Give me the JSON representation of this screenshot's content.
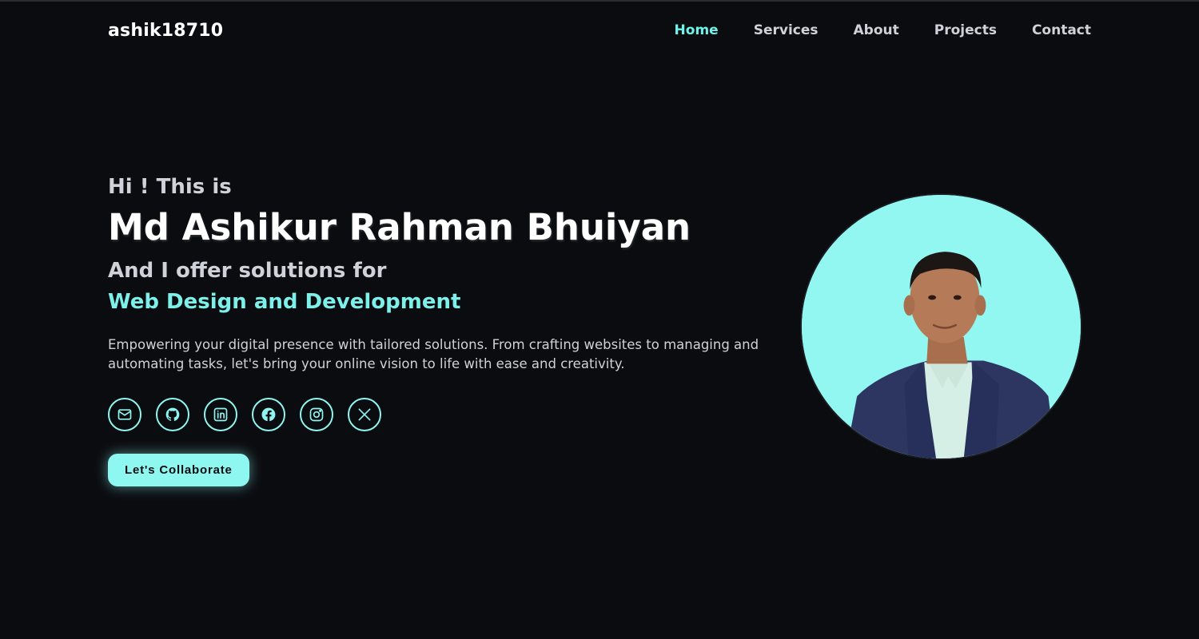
{
  "header": {
    "logo": "ashik18710",
    "nav": [
      {
        "label": "Home",
        "active": true
      },
      {
        "label": "Services",
        "active": false
      },
      {
        "label": "About",
        "active": false
      },
      {
        "label": "Projects",
        "active": false
      },
      {
        "label": "Contact",
        "active": false
      }
    ]
  },
  "hero": {
    "greeting": "Hi ! This is",
    "name": "Md Ashikur Rahman Bhuiyan",
    "offer": "And I offer solutions for",
    "role": "Web Design and Development",
    "description": "Empowering your digital presence with tailored solutions. From crafting websites to managing and automating tasks, let's bring your online vision to life with ease and creativity.",
    "socials": [
      "mail-icon",
      "github-icon",
      "linkedin-icon",
      "facebook-icon",
      "instagram-icon",
      "x-icon"
    ],
    "cta_label": "Let's Collaborate"
  },
  "colors": {
    "background": "#0b0c10",
    "accent": "#7ef0ea",
    "portrait_bg": "#91f7f0"
  }
}
